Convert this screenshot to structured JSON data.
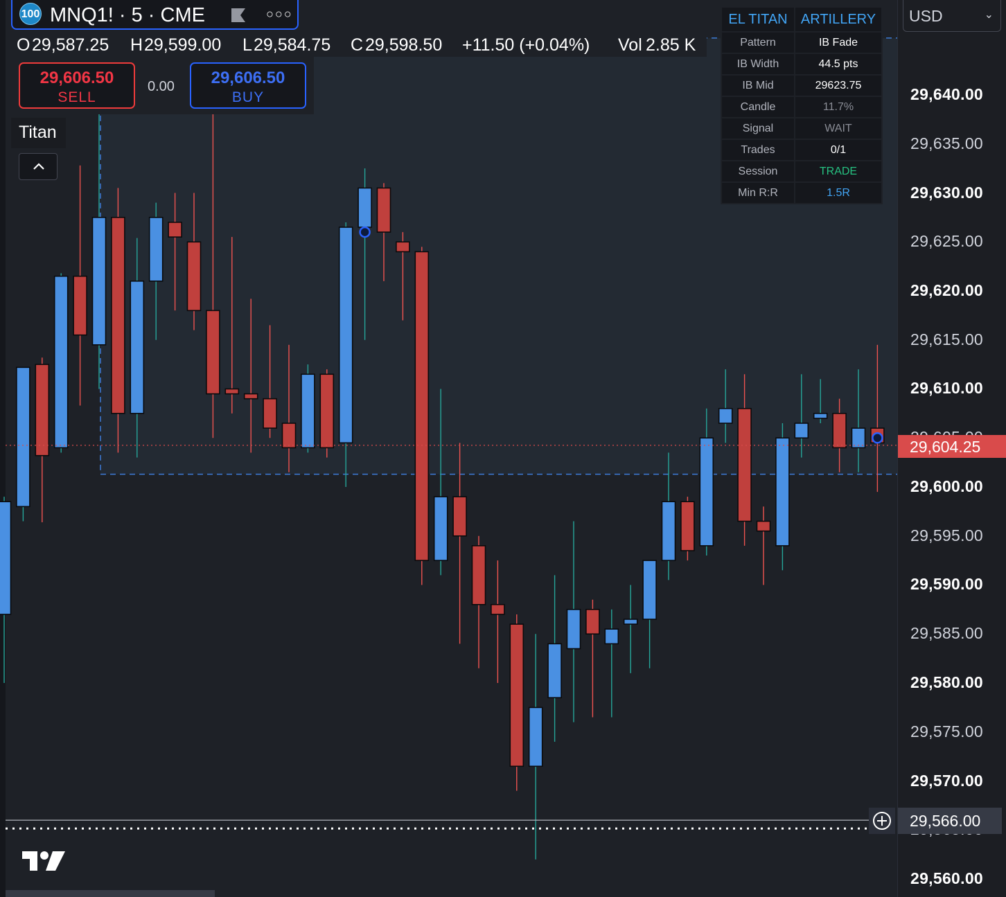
{
  "symbol": {
    "badge": "100",
    "title": "MNQ1! · 5 · CME",
    "flag_icon": "flag-icon",
    "more_icon": "more-options-icon"
  },
  "ohlc": {
    "o_label": "O",
    "o": "29,587.25",
    "h_label": "H",
    "h": "29,599.00",
    "l_label": "L",
    "l": "29,584.75",
    "c_label": "C",
    "c": "29,598.50",
    "change": "+11.50 (+0.04%)",
    "vol_label": "Vol",
    "vol": "2.85 K"
  },
  "trade": {
    "sell_price": "29,606.50",
    "sell_label": "SELL",
    "spread": "0.00",
    "buy_price": "29,606.50",
    "buy_label": "BUY"
  },
  "indicator": {
    "name": "Titan",
    "collapse_icon": "chevron-up-icon"
  },
  "currency": {
    "label": "USD",
    "chevron_icon": "chevron-down-icon"
  },
  "info_table": {
    "header_left": "EL TITAN",
    "header_right": "ARTILLERY",
    "rows": [
      {
        "key": "Pattern",
        "value": "IB Fade",
        "color": "#ffffff"
      },
      {
        "key": "IB Width",
        "value": "44.5 pts",
        "color": "#ffffff"
      },
      {
        "key": "IB Mid",
        "value": "29623.75",
        "color": "#ffffff"
      },
      {
        "key": "Candle",
        "value": "11.7%",
        "color": "#8a8d96"
      },
      {
        "key": "Signal",
        "value": "WAIT",
        "color": "#8a8d96"
      },
      {
        "key": "Trades",
        "value": "0/1",
        "color": "#ffffff"
      },
      {
        "key": "Session",
        "value": "TRADE",
        "color": "#26c281"
      },
      {
        "key": "Min R:R",
        "value": "1.5R",
        "color": "#42a5f5"
      }
    ]
  },
  "price_axis": {
    "ticks": [
      {
        "label": "29,640.00",
        "bold": true
      },
      {
        "label": "29,635.00",
        "bold": false
      },
      {
        "label": "29,630.00",
        "bold": true
      },
      {
        "label": "29,625.00",
        "bold": false
      },
      {
        "label": "29,620.00",
        "bold": true
      },
      {
        "label": "29,615.00",
        "bold": false
      },
      {
        "label": "29,610.00",
        "bold": true
      },
      {
        "label": "29,605.00",
        "bold": false
      },
      {
        "label": "29,600.00",
        "bold": true
      },
      {
        "label": "29,595.00",
        "bold": false
      },
      {
        "label": "29,590.00",
        "bold": true
      },
      {
        "label": "29,585.00",
        "bold": false
      },
      {
        "label": "29,580.00",
        "bold": true
      },
      {
        "label": "29,575.00",
        "bold": false
      },
      {
        "label": "29,570.00",
        "bold": true
      },
      {
        "label": "29,565.00",
        "bold": false
      },
      {
        "label": "29,560.00",
        "bold": true
      }
    ],
    "current_price": "29,604.25",
    "crosshair_price": "29,566.00",
    "plus_icon": "add-circle-icon"
  },
  "colors": {
    "up": "#4a90e2",
    "down": "#c0403d",
    "wick_up": "#26a69a",
    "wick_down": "#ef5350",
    "background": "#1e2127",
    "ib_zone": "#232a33",
    "ib_line": "#3d7bd6"
  },
  "chart_data": {
    "type": "candlestick",
    "title": "MNQ1! · 5 · CME",
    "ylim": [
      29559,
      29647
    ],
    "ib_high": 29645.8,
    "ib_low": 29601.3,
    "current_price": 29604.25,
    "crosshair_price": 29566.0,
    "candles": [
      {
        "o": 29587.0,
        "h": 29599.0,
        "l": 29580.0,
        "c": 29598.5
      },
      {
        "o": 29598.0,
        "h": 29611.0,
        "l": 29596.5,
        "c": 29612.2
      },
      {
        "o": 29612.5,
        "h": 29613.2,
        "l": 29596.4,
        "c": 29603.2
      },
      {
        "o": 29604.0,
        "h": 29621.8,
        "l": 29603.5,
        "c": 29621.5
      },
      {
        "o": 29621.5,
        "h": 29632.8,
        "l": 29608.3,
        "c": 29615.5
      },
      {
        "o": 29614.5,
        "h": 29646.0,
        "l": 29610.0,
        "c": 29627.5
      },
      {
        "o": 29627.5,
        "h": 29630.5,
        "l": 29603.5,
        "c": 29607.5
      },
      {
        "o": 29607.5,
        "h": 29625.4,
        "l": 29603.0,
        "c": 29621.0
      },
      {
        "o": 29621.0,
        "h": 29629.0,
        "l": 29615.0,
        "c": 29627.5
      },
      {
        "o": 29627.0,
        "h": 29630.0,
        "l": 29618.0,
        "c": 29625.5
      },
      {
        "o": 29625.0,
        "h": 29630.0,
        "l": 29616.0,
        "c": 29618.0
      },
      {
        "o": 29618.0,
        "h": 29640.0,
        "l": 29605.0,
        "c": 29609.5
      },
      {
        "o": 29610.0,
        "h": 29625.5,
        "l": 29607.5,
        "c": 29609.5
      },
      {
        "o": 29609.5,
        "h": 29619.2,
        "l": 29603.5,
        "c": 29609.0
      },
      {
        "o": 29609.0,
        "h": 29616.5,
        "l": 29605.0,
        "c": 29606.0
      },
      {
        "o": 29606.5,
        "h": 29614.5,
        "l": 29601.5,
        "c": 29604.0
      },
      {
        "o": 29604.0,
        "h": 29612.5,
        "l": 29603.5,
        "c": 29611.5
      },
      {
        "o": 29611.5,
        "h": 29612.0,
        "l": 29603.0,
        "c": 29604.0
      },
      {
        "o": 29604.5,
        "h": 29627.0,
        "l": 29600.0,
        "c": 29626.5
      },
      {
        "o": 29626.5,
        "h": 29632.5,
        "l": 29615.0,
        "c": 29630.5
      },
      {
        "o": 29630.5,
        "h": 29631.0,
        "l": 29621.0,
        "c": 29626.0
      },
      {
        "o": 29625.0,
        "h": 29626.0,
        "l": 29617.0,
        "c": 29624.0
      },
      {
        "o": 29624.0,
        "h": 29624.5,
        "l": 29590.0,
        "c": 29592.5
      },
      {
        "o": 29592.5,
        "h": 29610.0,
        "l": 29591.0,
        "c": 29599.0
      },
      {
        "o": 29599.0,
        "h": 29604.5,
        "l": 29584.0,
        "c": 29595.0
      },
      {
        "o": 29594.0,
        "h": 29595.0,
        "l": 29581.5,
        "c": 29588.0
      },
      {
        "o": 29588.0,
        "h": 29592.5,
        "l": 29580.0,
        "c": 29587.0
      },
      {
        "o": 29586.0,
        "h": 29587.0,
        "l": 29569.0,
        "c": 29571.5
      },
      {
        "o": 29571.5,
        "h": 29585.0,
        "l": 29562.0,
        "c": 29577.5
      },
      {
        "o": 29578.5,
        "h": 29591.0,
        "l": 29574.0,
        "c": 29584.0
      },
      {
        "o": 29583.5,
        "h": 29596.5,
        "l": 29576.0,
        "c": 29587.5
      },
      {
        "o": 29587.5,
        "h": 29588.5,
        "l": 29576.5,
        "c": 29585.0
      },
      {
        "o": 29584.0,
        "h": 29587.5,
        "l": 29576.5,
        "c": 29585.5
      },
      {
        "o": 29586.0,
        "h": 29590.0,
        "l": 29581.0,
        "c": 29586.5
      },
      {
        "o": 29586.5,
        "h": 29592.5,
        "l": 29581.5,
        "c": 29592.5
      },
      {
        "o": 29592.5,
        "h": 29603.5,
        "l": 29590.5,
        "c": 29598.5
      },
      {
        "o": 29598.5,
        "h": 29599.0,
        "l": 29592.5,
        "c": 29593.5
      },
      {
        "o": 29594.0,
        "h": 29608.0,
        "l": 29593.0,
        "c": 29605.0
      },
      {
        "o": 29606.5,
        "h": 29612.0,
        "l": 29604.5,
        "c": 29608.0
      },
      {
        "o": 29608.0,
        "h": 29611.5,
        "l": 29594.0,
        "c": 29596.5
      },
      {
        "o": 29596.5,
        "h": 29598.0,
        "l": 29590.0,
        "c": 29595.5
      },
      {
        "o": 29594.0,
        "h": 29606.5,
        "l": 29591.5,
        "c": 29605.0
      },
      {
        "o": 29605.0,
        "h": 29611.5,
        "l": 29603.0,
        "c": 29606.5
      },
      {
        "o": 29607.0,
        "h": 29611.0,
        "l": 29606.5,
        "c": 29607.5
      },
      {
        "o": 29607.5,
        "h": 29609.0,
        "l": 29601.5,
        "c": 29604.0
      },
      {
        "o": 29604.0,
        "h": 29612.0,
        "l": 29601.5,
        "c": 29606.0
      },
      {
        "o": 29606.0,
        "h": 29614.5,
        "l": 29599.5,
        "c": 29604.5
      }
    ],
    "markers": [
      {
        "index": 19,
        "price": 29626.0
      },
      {
        "index": 46,
        "price": 29605.0
      }
    ]
  }
}
